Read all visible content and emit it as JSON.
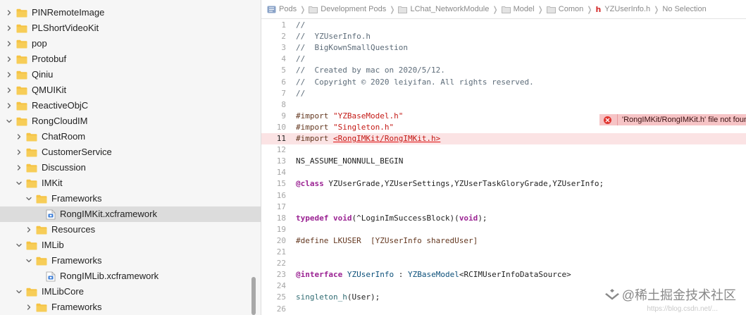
{
  "colors": {
    "folder": "#f5c344",
    "selection": "#dcdcdc",
    "error": "#e0352f",
    "error_line": "#fbe3e4",
    "keyword": "#9b2393",
    "string": "#c41a16",
    "comment": "#5d6c79"
  },
  "navigator": {
    "items": [
      {
        "label": "PINRemoteImage",
        "indent": 0,
        "icon": "folder-icon",
        "expanded": false
      },
      {
        "label": "PLShortVideoKit",
        "indent": 0,
        "icon": "folder-icon",
        "expanded": false
      },
      {
        "label": "pop",
        "indent": 0,
        "icon": "folder-icon",
        "expanded": false
      },
      {
        "label": "Protobuf",
        "indent": 0,
        "icon": "folder-icon",
        "expanded": false
      },
      {
        "label": "Qiniu",
        "indent": 0,
        "icon": "folder-icon",
        "expanded": false
      },
      {
        "label": "QMUIKit",
        "indent": 0,
        "icon": "folder-icon",
        "expanded": false
      },
      {
        "label": "ReactiveObjC",
        "indent": 0,
        "icon": "folder-icon",
        "expanded": false
      },
      {
        "label": "RongCloudIM",
        "indent": 0,
        "icon": "folder-icon",
        "expanded": true
      },
      {
        "label": "ChatRoom",
        "indent": 1,
        "icon": "folder-icon",
        "expanded": false
      },
      {
        "label": "CustomerService",
        "indent": 1,
        "icon": "folder-icon",
        "expanded": false
      },
      {
        "label": "Discussion",
        "indent": 1,
        "icon": "folder-icon",
        "expanded": false
      },
      {
        "label": "IMKit",
        "indent": 1,
        "icon": "folder-icon",
        "expanded": true
      },
      {
        "label": "Frameworks",
        "indent": 2,
        "icon": "folder-icon",
        "expanded": true
      },
      {
        "label": "RongIMKit.xcframework",
        "indent": 3,
        "icon": "xcframework-icon",
        "selected": true
      },
      {
        "label": "Resources",
        "indent": 2,
        "icon": "folder-icon",
        "expanded": false
      },
      {
        "label": "IMLib",
        "indent": 1,
        "icon": "folder-icon",
        "expanded": true
      },
      {
        "label": "Frameworks",
        "indent": 2,
        "icon": "folder-icon",
        "expanded": true
      },
      {
        "label": "RongIMLib.xcframework",
        "indent": 3,
        "icon": "xcframework-icon"
      },
      {
        "label": "IMLibCore",
        "indent": 1,
        "icon": "folder-icon",
        "expanded": true
      },
      {
        "label": "Frameworks",
        "indent": 2,
        "icon": "folder-icon",
        "expanded": false
      }
    ]
  },
  "jumpbar": {
    "crumbs": [
      {
        "label": "Pods",
        "icon": "project-icon"
      },
      {
        "label": "Development Pods",
        "icon": "folder-icon"
      },
      {
        "label": "LChat_NetworkModule",
        "icon": "folder-icon"
      },
      {
        "label": "Model",
        "icon": "folder-icon"
      },
      {
        "label": "Comon",
        "icon": "folder-icon"
      },
      {
        "label": "YZUserInfo.h",
        "icon": "header-file-icon",
        "badge": "h"
      },
      {
        "label": "No Selection",
        "icon": null
      }
    ]
  },
  "code": {
    "lines": [
      {
        "n": "1",
        "tokens": [
          {
            "t": "//",
            "c": "comment"
          }
        ]
      },
      {
        "n": "2",
        "tokens": [
          {
            "t": "//  YZUserInfo.h",
            "c": "comment"
          }
        ]
      },
      {
        "n": "3",
        "tokens": [
          {
            "t": "//  BigKownSmallQuestion",
            "c": "comment"
          }
        ]
      },
      {
        "n": "4",
        "tokens": [
          {
            "t": "//",
            "c": "comment"
          }
        ]
      },
      {
        "n": "5",
        "tokens": [
          {
            "t": "//  Created by mac on 2020/5/12.",
            "c": "comment"
          }
        ]
      },
      {
        "n": "6",
        "tokens": [
          {
            "t": "//  Copyright © 2020 leiyifan. All rights reserved.",
            "c": "comment"
          }
        ]
      },
      {
        "n": "7",
        "tokens": [
          {
            "t": "//",
            "c": "comment"
          }
        ]
      },
      {
        "n": "8",
        "tokens": []
      },
      {
        "n": "9",
        "tokens": [
          {
            "t": "#import ",
            "c": "pp"
          },
          {
            "t": "\"YZBaseModel.h\"",
            "c": "str"
          }
        ]
      },
      {
        "n": "10",
        "tokens": [
          {
            "t": "#import ",
            "c": "pp"
          },
          {
            "t": "\"Singleton.h\"",
            "c": "str"
          }
        ]
      },
      {
        "n": "11",
        "error": true,
        "tokens": [
          {
            "t": "#import ",
            "c": "pp"
          },
          {
            "t": "<RongIMKit/RongIMKit.h>",
            "c": "err"
          }
        ]
      },
      {
        "n": "12",
        "tokens": []
      },
      {
        "n": "13",
        "tokens": [
          {
            "t": "NS_ASSUME_NONNULL_BEGIN",
            "c": "plain"
          }
        ]
      },
      {
        "n": "14",
        "tokens": []
      },
      {
        "n": "15",
        "tokens": [
          {
            "t": "@class",
            "c": "kw"
          },
          {
            "t": " YZUserGrade,YZUserSettings,YZUserTaskGloryGrade,YZUserInfo;",
            "c": "plain"
          }
        ]
      },
      {
        "n": "16",
        "tokens": []
      },
      {
        "n": "17",
        "tokens": []
      },
      {
        "n": "18",
        "tokens": [
          {
            "t": "typedef",
            "c": "kw"
          },
          {
            "t": " ",
            "c": "plain"
          },
          {
            "t": "void",
            "c": "kw"
          },
          {
            "t": "(^LoginImSuccessBlock)(",
            "c": "plain"
          },
          {
            "t": "void",
            "c": "kw"
          },
          {
            "t": ");",
            "c": "plain"
          }
        ]
      },
      {
        "n": "19",
        "tokens": []
      },
      {
        "n": "20",
        "tokens": [
          {
            "t": "#define LKUSER  [YZUserInfo sharedUser]",
            "c": "pp"
          }
        ]
      },
      {
        "n": "21",
        "tokens": []
      },
      {
        "n": "22",
        "tokens": []
      },
      {
        "n": "23",
        "tokens": [
          {
            "t": "@interface",
            "c": "kw"
          },
          {
            "t": " ",
            "c": "plain"
          },
          {
            "t": "YZUserInfo",
            "c": "type"
          },
          {
            "t": " : ",
            "c": "plain"
          },
          {
            "t": "YZBaseModel",
            "c": "type"
          },
          {
            "t": "<RCIMUserInfoDataSource>",
            "c": "plain"
          }
        ]
      },
      {
        "n": "24",
        "tokens": []
      },
      {
        "n": "25",
        "tokens": [
          {
            "t": "singleton_h",
            "c": "fn"
          },
          {
            "t": "(User);",
            "c": "plain"
          }
        ]
      },
      {
        "n": "26",
        "tokens": []
      }
    ]
  },
  "error_badge": {
    "line": "11",
    "message": "'RongIMKit/RongIMKit.h' file not found"
  },
  "watermark": {
    "text": "@稀土掘金技术社区",
    "faint": "https://blog.csdn.net/..."
  }
}
